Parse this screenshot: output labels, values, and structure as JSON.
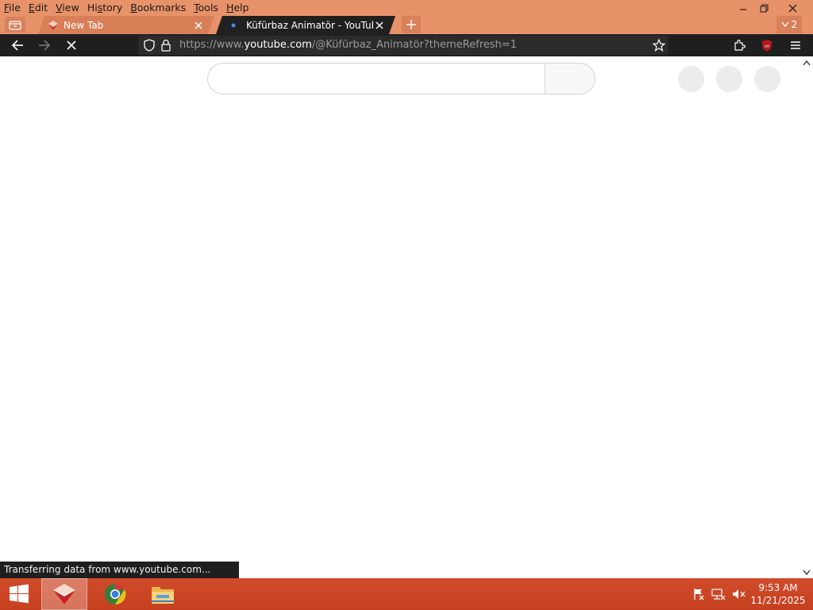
{
  "menu": {
    "items": [
      {
        "label": "File",
        "key": "F"
      },
      {
        "label": "Edit",
        "key": "E"
      },
      {
        "label": "View",
        "key": "V"
      },
      {
        "label": "History",
        "key": "s"
      },
      {
        "label": "Bookmarks",
        "key": "B"
      },
      {
        "label": "Tools",
        "key": "T"
      },
      {
        "label": "Help",
        "key": "H"
      }
    ]
  },
  "tabs": [
    {
      "title": "New Tab",
      "active": false
    },
    {
      "title": "Küfürbaz Animatör - YouTube",
      "active": true
    }
  ],
  "tab_count_label": "2",
  "address_bar": {
    "url_prefix": "https://www.",
    "url_domain": "youtube.com",
    "url_path": "/@Küfürbaz_Animatör?themeRefresh=1"
  },
  "status_text": "Transferring data from www.youtube.com...",
  "clock": {
    "time": "9:53 AM",
    "date": "11/21/2025"
  },
  "colors": {
    "theme_accent": "#e8926a",
    "toolbar_dark": "#1f1f1f",
    "taskbar": "#c5401f"
  },
  "icons": [
    "tab-list-icon",
    "youtube-favicon",
    "close-icon",
    "plus-icon",
    "chevron-down-icon",
    "back-arrow-icon",
    "forward-arrow-icon",
    "stop-icon",
    "shield-icon",
    "lock-icon",
    "star-icon",
    "extensions-icon",
    "ublock-icon",
    "hamburger-menu-icon",
    "windows-start-icon",
    "browser-app-icon",
    "chrome-app-icon",
    "file-explorer-icon",
    "flag-icon",
    "network-icon",
    "speaker-muted-icon"
  ]
}
